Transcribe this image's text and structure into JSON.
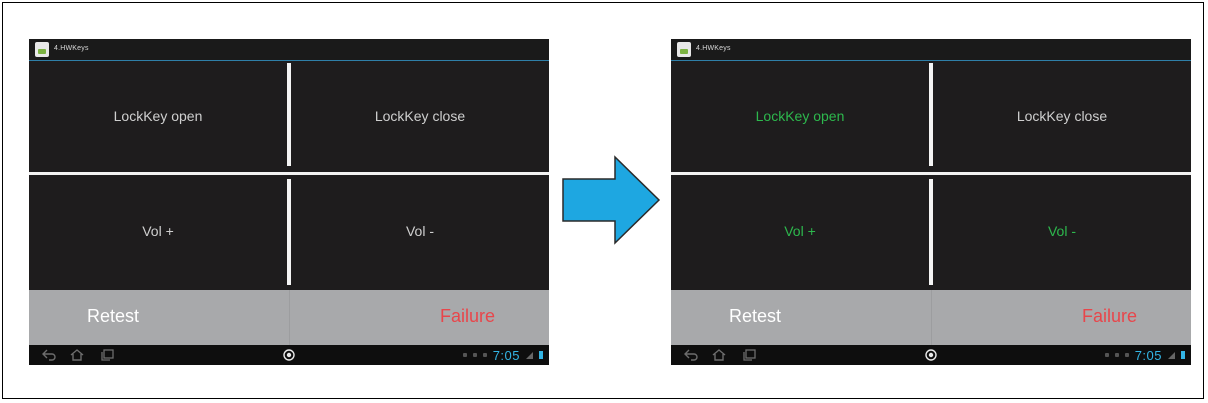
{
  "screens": [
    {
      "app_title": "4.HWKeys",
      "keys": {
        "lock_open": "LockKey open",
        "lock_close": "LockKey close",
        "vol_up": "Vol +",
        "vol_down": "Vol -"
      },
      "passed": [],
      "buttons": {
        "retest": "Retest",
        "failure": "Failure"
      },
      "status": {
        "time": "7:05"
      }
    },
    {
      "app_title": "4.HWKeys",
      "keys": {
        "lock_open": "LockKey open",
        "lock_close": "LockKey close",
        "vol_up": "Vol +",
        "vol_down": "Vol -"
      },
      "passed": [
        "lock_open",
        "vol_up",
        "vol_down"
      ],
      "buttons": {
        "retest": "Retest",
        "failure": "Failure"
      },
      "status": {
        "time": "7:05"
      }
    }
  ],
  "colors": {
    "passed_text": "#2db84d",
    "default_text": "#cfcfcf",
    "failure_text": "#e8464b",
    "arrow_fill": "#1ea7e1",
    "clock": "#33b5e5"
  },
  "icons": {
    "flow_arrow": "right-arrow-icon",
    "nav_back": "back-icon",
    "nav_home": "home-icon",
    "nav_recent": "recent-apps-icon",
    "nav_center": "circle-menu-icon"
  }
}
